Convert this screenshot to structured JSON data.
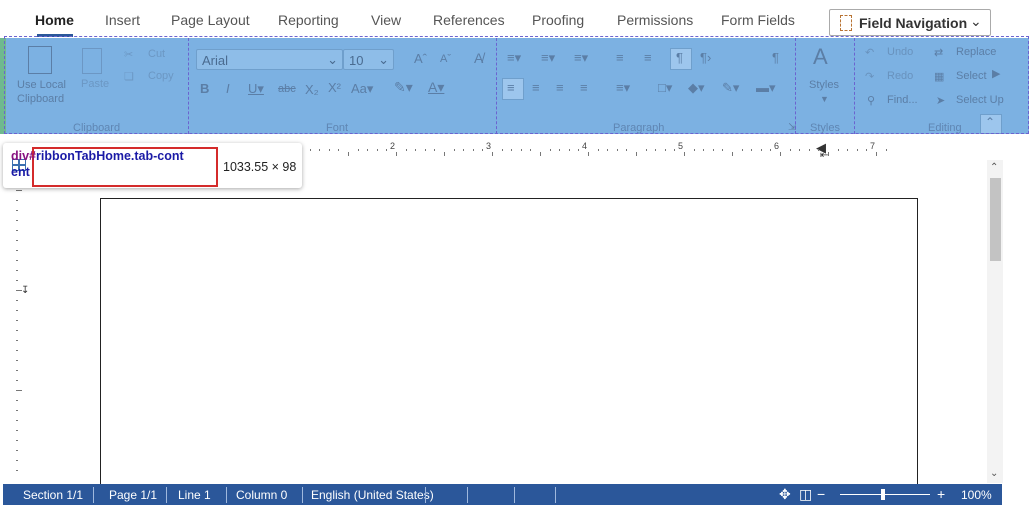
{
  "tabs": [
    {
      "label": "Home",
      "active": true
    },
    {
      "label": "Insert"
    },
    {
      "label": "Page Layout"
    },
    {
      "label": "Reporting"
    },
    {
      "label": "View"
    },
    {
      "label": "References"
    },
    {
      "label": "Proofing"
    },
    {
      "label": "Permissions"
    },
    {
      "label": "Form Fields"
    }
  ],
  "field_navigation": {
    "label": "Field Navigation"
  },
  "ribbon": {
    "clipboard": {
      "group_label": "Clipboard",
      "use_local_label": "Use Local\nClipboard",
      "paste_label": "Paste",
      "cut_label": "Cut",
      "copy_label": "Copy"
    },
    "font": {
      "group_label": "Font",
      "font_name": "Arial",
      "font_size": "10",
      "case_label": "Aa"
    },
    "paragraph": {
      "group_label": "Paragraph"
    },
    "styles": {
      "group_label": "Styles",
      "styles_label": "Styles"
    },
    "editing": {
      "group_label": "Editing",
      "undo_label": "Undo",
      "redo_label": "Redo",
      "find_label": "Find...",
      "replace_label": "Replace",
      "select_label": "Select",
      "select_up_label": "Select Up"
    }
  },
  "inspector_tooltip": {
    "element_tag": "div#",
    "element_selector": "ribbonTabHome.tab-content",
    "size": "1033.55 × 98"
  },
  "ruler": {
    "h_numbers": [
      "2",
      "3",
      "4",
      "5",
      "6",
      "7"
    ]
  },
  "status_bar": {
    "section": "Section 1/1",
    "page": "Page 1/1",
    "line": "Line 1",
    "column": "Column 0",
    "language": "English (United States)",
    "zoom": "100%",
    "zoom_out": "−",
    "zoom_in": "+"
  },
  "colors": {
    "accent": "#2b579a",
    "ribbon_highlight": "#7cb1e2",
    "selector_border": "#d42b2b"
  }
}
